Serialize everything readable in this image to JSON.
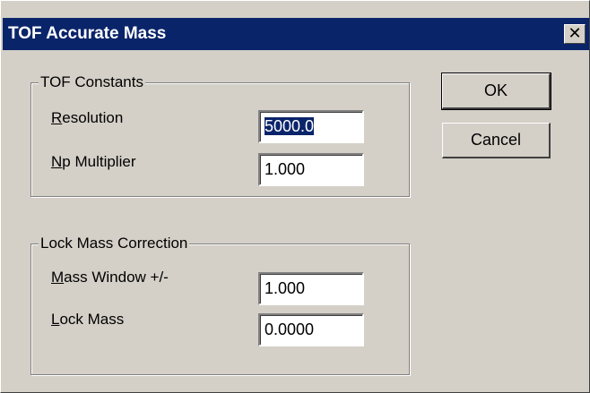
{
  "window": {
    "title": "TOF Accurate Mass",
    "close_glyph": "✕"
  },
  "tof_constants": {
    "legend": "TOF Constants",
    "resolution": {
      "label_accel": "R",
      "label_rest": "esolution",
      "value": "5000.0"
    },
    "np_multiplier": {
      "label_accel": "N",
      "label_rest": "p Multiplier",
      "value": "1.000"
    }
  },
  "lock_mass_correction": {
    "legend": "Lock Mass Correction",
    "mass_window": {
      "label_accel": "M",
      "label_rest": "ass Window +/-",
      "value": "1.000"
    },
    "lock_mass": {
      "label_accel": "L",
      "label_rest": "ock Mass",
      "value": "0.0000"
    }
  },
  "buttons": {
    "ok": "OK",
    "cancel": "Cancel"
  },
  "colors": {
    "titlebar": "#0a246a",
    "dialog_bg": "#d4d0c8",
    "selection": "#0a246a"
  }
}
